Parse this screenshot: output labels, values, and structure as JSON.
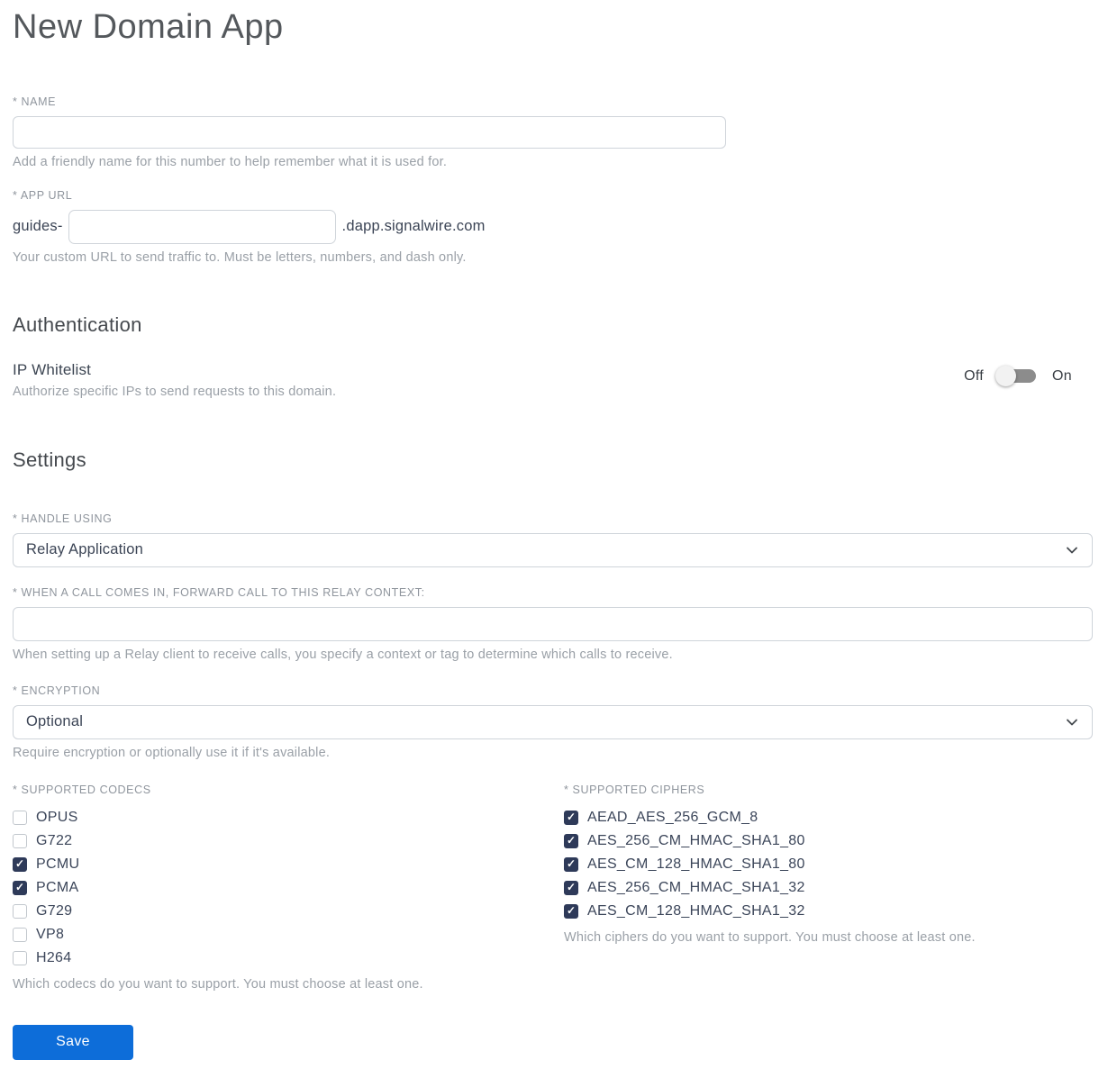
{
  "page": {
    "title": "New Domain App"
  },
  "name_field": {
    "label": "* NAME",
    "value": "",
    "helper": "Add a friendly name for this number to help remember what it is used for."
  },
  "app_url_field": {
    "label": "* APP URL",
    "prefix": "guides-",
    "value": "",
    "suffix": ".dapp.signalwire.com",
    "helper": "Your custom URL to send traffic to. Must be letters, numbers, and dash only."
  },
  "authentication": {
    "heading": "Authentication",
    "ip_whitelist": {
      "label": "IP Whitelist",
      "helper": "Authorize specific IPs to send requests to this domain.",
      "off_label": "Off",
      "on_label": "On",
      "enabled": false
    }
  },
  "settings": {
    "heading": "Settings",
    "handle_using": {
      "label": "* HANDLE USING",
      "selected": "Relay Application"
    },
    "relay_context": {
      "label": "* WHEN A CALL COMES IN, FORWARD CALL TO THIS RELAY CONTEXT:",
      "value": "",
      "helper": "When setting up a Relay client to receive calls, you specify a context or tag to determine which calls to receive."
    },
    "encryption": {
      "label": "* ENCRYPTION",
      "selected": "Optional",
      "helper": "Require encryption or optionally use it if it's available."
    },
    "codecs": {
      "label": "* SUPPORTED CODECS",
      "helper": "Which codecs do you want to support. You must choose at least one.",
      "items": [
        {
          "label": "OPUS",
          "checked": false
        },
        {
          "label": "G722",
          "checked": false
        },
        {
          "label": "PCMU",
          "checked": true
        },
        {
          "label": "PCMA",
          "checked": true
        },
        {
          "label": "G729",
          "checked": false
        },
        {
          "label": "VP8",
          "checked": false
        },
        {
          "label": "H264",
          "checked": false
        }
      ]
    },
    "ciphers": {
      "label": "* SUPPORTED CIPHERS",
      "helper": "Which ciphers do you want to support. You must choose at least one.",
      "items": [
        {
          "label": "AEAD_AES_256_GCM_8",
          "checked": true
        },
        {
          "label": "AES_256_CM_HMAC_SHA1_80",
          "checked": true
        },
        {
          "label": "AES_CM_128_HMAC_SHA1_80",
          "checked": true
        },
        {
          "label": "AES_256_CM_HMAC_SHA1_32",
          "checked": true
        },
        {
          "label": "AES_CM_128_HMAC_SHA1_32",
          "checked": true
        }
      ]
    }
  },
  "actions": {
    "save_label": "Save"
  },
  "icons": {
    "checkmark": "✓",
    "chevron_down": "chevron-down"
  },
  "colors": {
    "accent_blue": "#0d6dd9",
    "checkbox_checked": "#2e3a59",
    "toggle_track": "#8c8c8c",
    "toggle_knob": "#f2f2f2"
  }
}
